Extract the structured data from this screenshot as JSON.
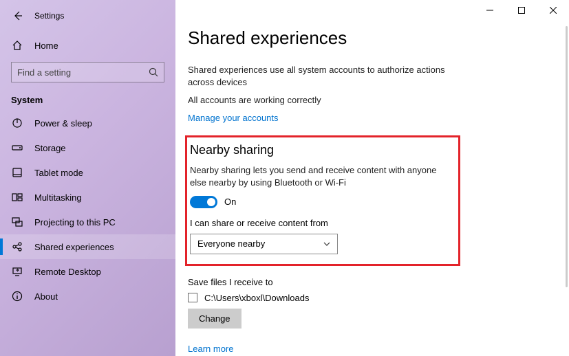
{
  "window": {
    "title": "Settings"
  },
  "sidebar": {
    "home": "Home",
    "search_placeholder": "Find a setting",
    "category": "System",
    "items": [
      {
        "label": "Power & sleep"
      },
      {
        "label": "Storage"
      },
      {
        "label": "Tablet mode"
      },
      {
        "label": "Multitasking"
      },
      {
        "label": "Projecting to this PC"
      },
      {
        "label": "Shared experiences"
      },
      {
        "label": "Remote Desktop"
      },
      {
        "label": "About"
      }
    ]
  },
  "main": {
    "title": "Shared experiences",
    "intro": "Shared experiences use all system accounts to authorize actions across devices",
    "status": "All accounts are working correctly",
    "manage_link": "Manage your accounts",
    "nearby": {
      "heading": "Nearby sharing",
      "desc": "Nearby sharing lets you send and receive content with anyone else nearby by using Bluetooth or Wi-Fi",
      "toggle_label": "On",
      "dropdown_label": "I can share or receive content from",
      "dropdown_value": "Everyone nearby"
    },
    "save": {
      "label": "Save files I receive to",
      "path": "C:\\Users\\xboxl\\Downloads",
      "button": "Change"
    },
    "learn_more": "Learn more"
  }
}
